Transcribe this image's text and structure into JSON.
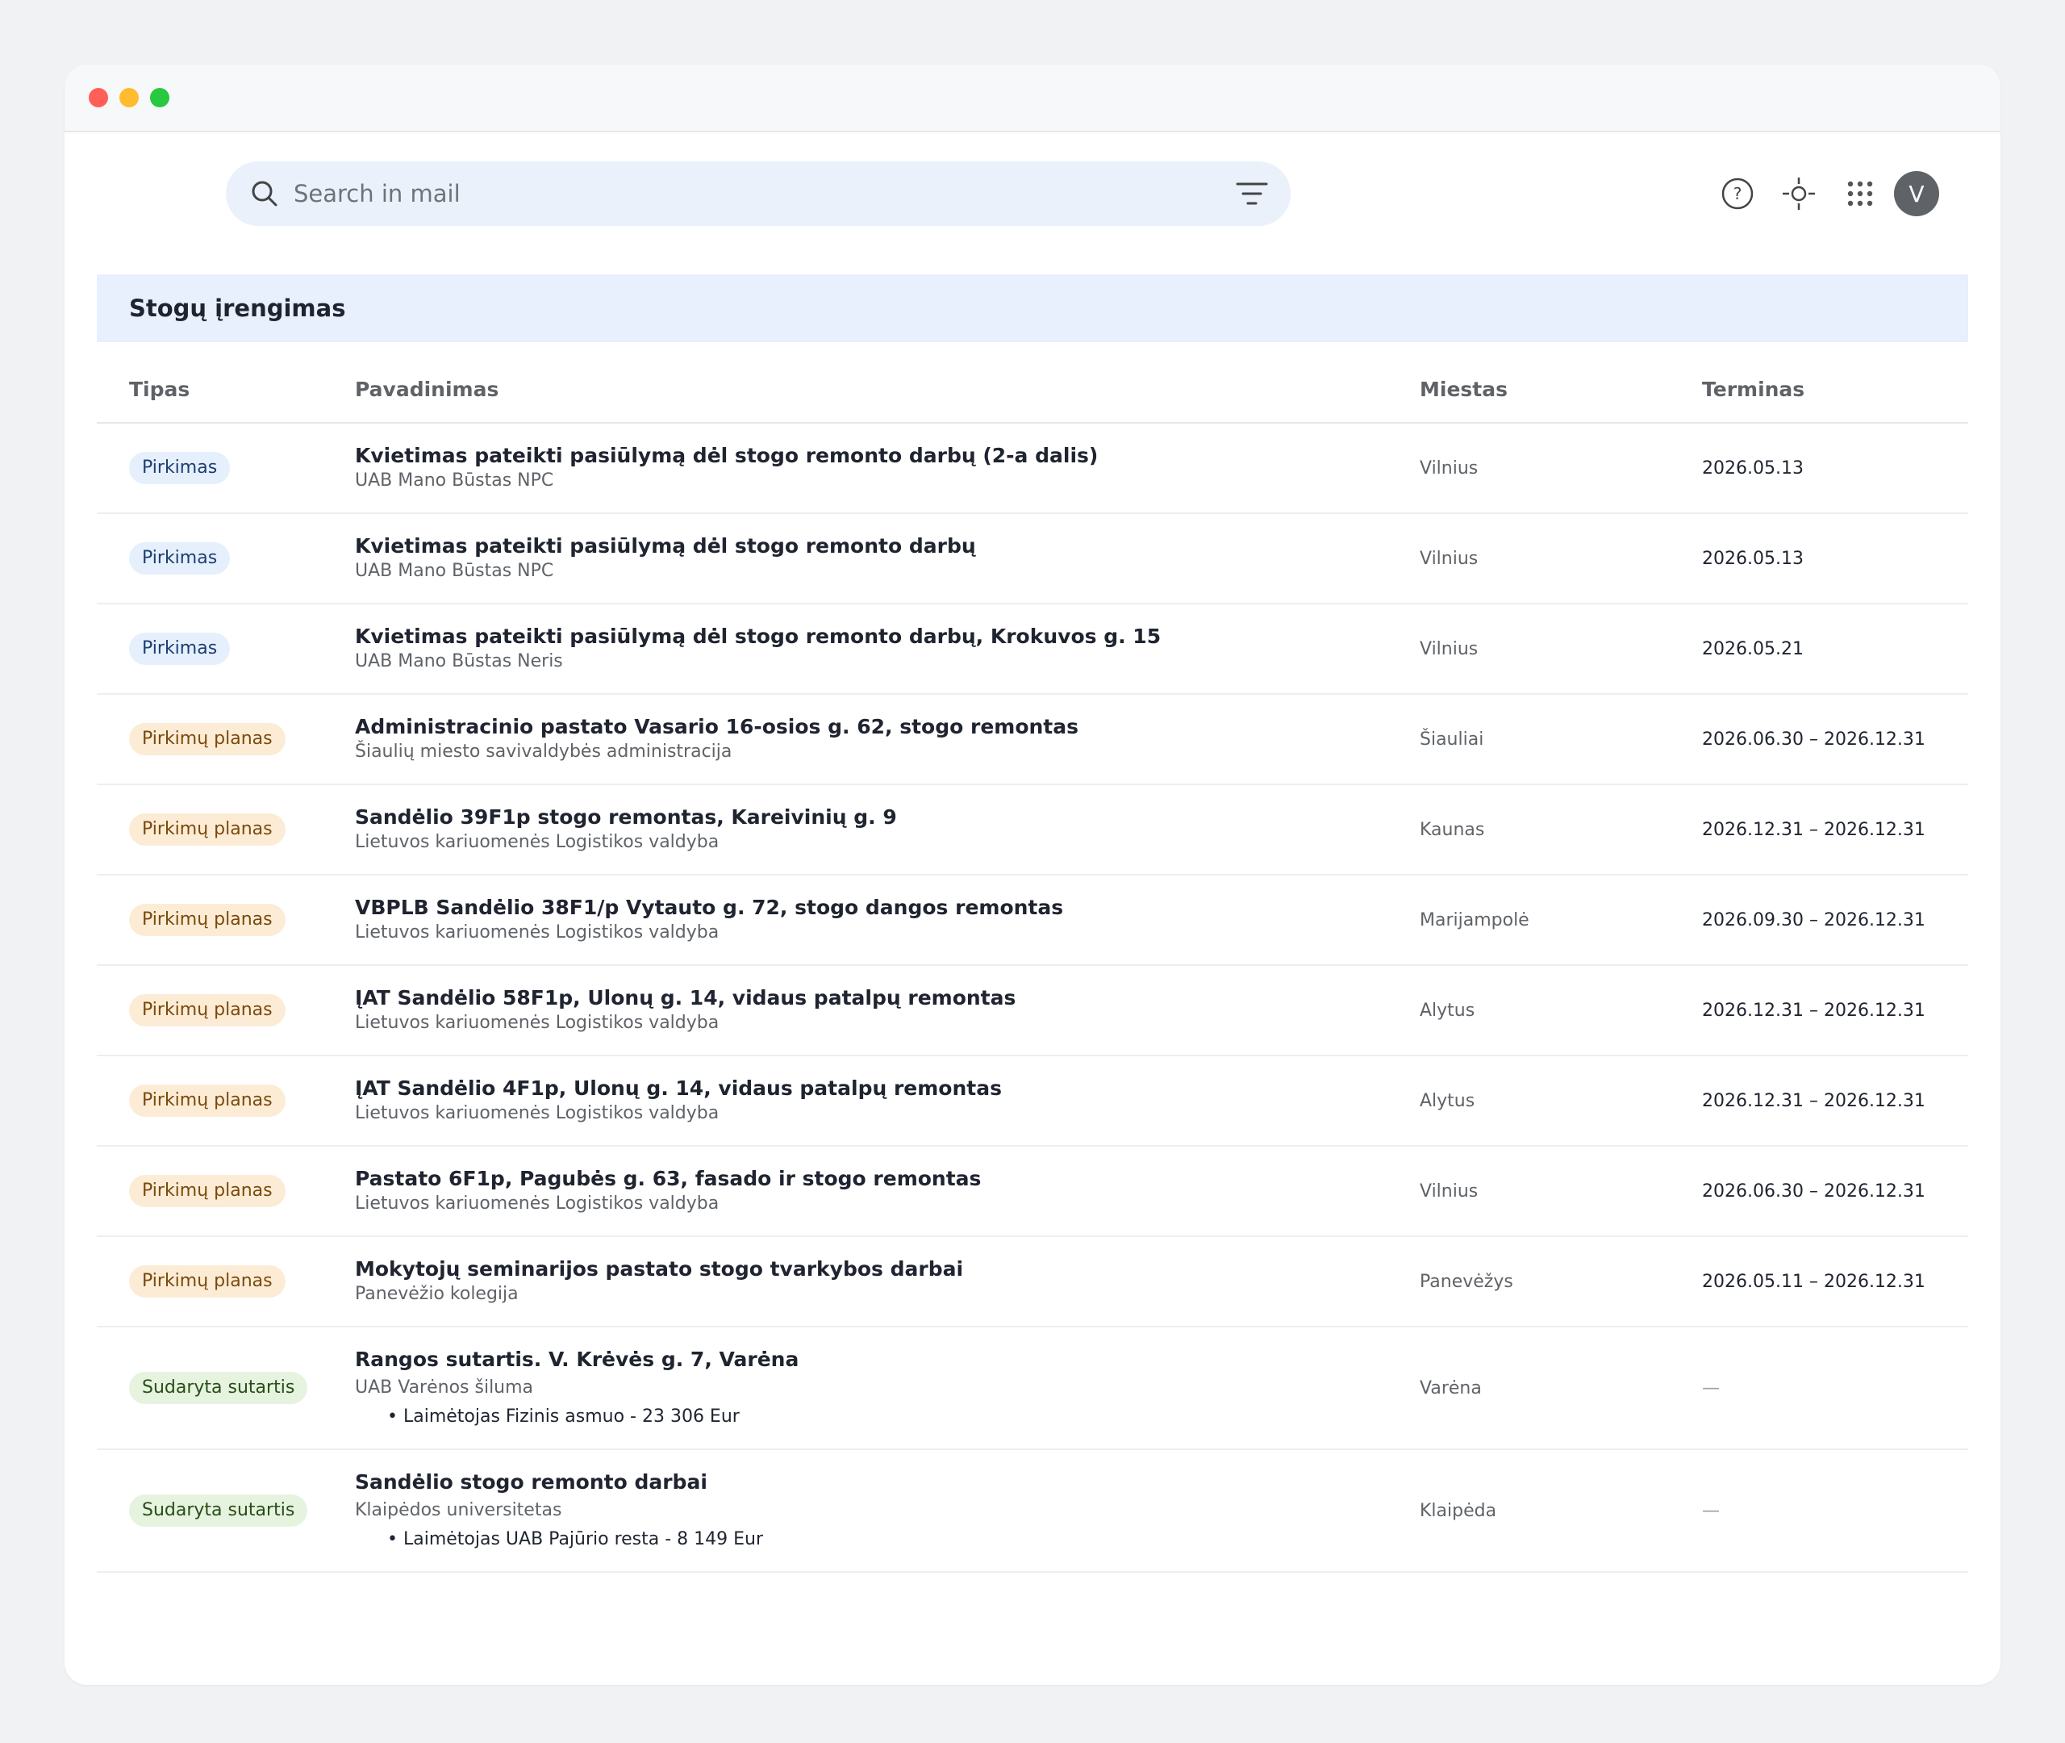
{
  "search": {
    "placeholder": "Search in mail"
  },
  "header": {
    "avatar_initial": "V"
  },
  "icons": {
    "search": "search-icon",
    "filter": "filter-icon",
    "help": "help-icon",
    "settings": "settings-icon",
    "apps": "apps-grid-icon"
  },
  "section": {
    "title": "Stogų įrengimas"
  },
  "columns": {
    "type": "Tipas",
    "name": "Pavadinimas",
    "city": "Miestas",
    "term": "Terminas"
  },
  "rows": [
    {
      "type": "Pirkimas",
      "kind": "pirkimas",
      "title": "Kvietimas pateikti pasiūlymą dėl stogo remonto darbų (2-a dalis)",
      "org": "UAB Mano Būstas NPC",
      "city": "Vilnius",
      "term": "2026.05.13"
    },
    {
      "type": "Pirkimas",
      "kind": "pirkimas",
      "title": "Kvietimas pateikti pasiūlymą dėl stogo remonto darbų",
      "org": "UAB Mano Būstas NPC",
      "city": "Vilnius",
      "term": "2026.05.13"
    },
    {
      "type": "Pirkimas",
      "kind": "pirkimas",
      "title": "Kvietimas pateikti pasiūlymą dėl stogo remonto darbų, Krokuvos g. 15",
      "org": "UAB Mano Būstas Neris",
      "city": "Vilnius",
      "term": "2026.05.21"
    },
    {
      "type": "Pirkimų planas",
      "kind": "planas",
      "title": "Administracinio pastato Vasario 16-osios g. 62, stogo remontas",
      "org": "Šiaulių miesto savivaldybės administracija",
      "city": "Šiauliai",
      "term": "2026.06.30 – 2026.12.31"
    },
    {
      "type": "Pirkimų planas",
      "kind": "planas",
      "title": "Sandėlio 39F1p stogo remontas, Kareivinių g. 9",
      "org": "Lietuvos kariuomenės Logistikos valdyba",
      "city": "Kaunas",
      "term": "2026.12.31 – 2026.12.31"
    },
    {
      "type": "Pirkimų planas",
      "kind": "planas",
      "title": "VBPLB Sandėlio 38F1/p Vytauto g. 72, stogo dangos remontas",
      "org": "Lietuvos kariuomenės Logistikos valdyba",
      "city": "Marijampolė",
      "term": "2026.09.30 – 2026.12.31"
    },
    {
      "type": "Pirkimų planas",
      "kind": "planas",
      "title": "ĮAT Sandėlio 58F1p, Ulonų g. 14, vidaus patalpų remontas",
      "org": "Lietuvos kariuomenės Logistikos valdyba",
      "city": "Alytus",
      "term": "2026.12.31 – 2026.12.31"
    },
    {
      "type": "Pirkimų planas",
      "kind": "planas",
      "title": "ĮAT Sandėlio 4F1p, Ulonų g. 14, vidaus patalpų remontas",
      "org": "Lietuvos kariuomenės Logistikos valdyba",
      "city": "Alytus",
      "term": "2026.12.31 – 2026.12.31"
    },
    {
      "type": "Pirkimų planas",
      "kind": "planas",
      "title": "Pastato 6F1p, Pagubės g. 63, fasado ir stogo remontas",
      "org": "Lietuvos kariuomenės Logistikos valdyba",
      "city": "Vilnius",
      "term": "2026.06.30 – 2026.12.31"
    },
    {
      "type": "Pirkimų planas",
      "kind": "planas",
      "title": "Mokytojų seminarijos pastato stogo tvarkybos darbai",
      "org": "Panevėžio kolegija",
      "city": "Panevėžys",
      "term": "2026.05.11 – 2026.12.31"
    },
    {
      "type": "Sudaryta sutartis",
      "kind": "sutartis",
      "title": "Rangos sutartis. V. Krėvės g. 7, Varėna",
      "org": "UAB Varėnos šiluma",
      "winner": "• Laimėtojas Fizinis asmuo - 23 306 Eur",
      "city": "Varėna",
      "term": "—"
    },
    {
      "type": "Sudaryta sutartis",
      "kind": "sutartis",
      "title": "Sandėlio stogo remonto darbai",
      "org": "Klaipėdos universitetas",
      "winner": "• Laimėtojas UAB Pajūrio resta - 8 149 Eur",
      "city": "Klaipėda",
      "term": "—"
    }
  ]
}
